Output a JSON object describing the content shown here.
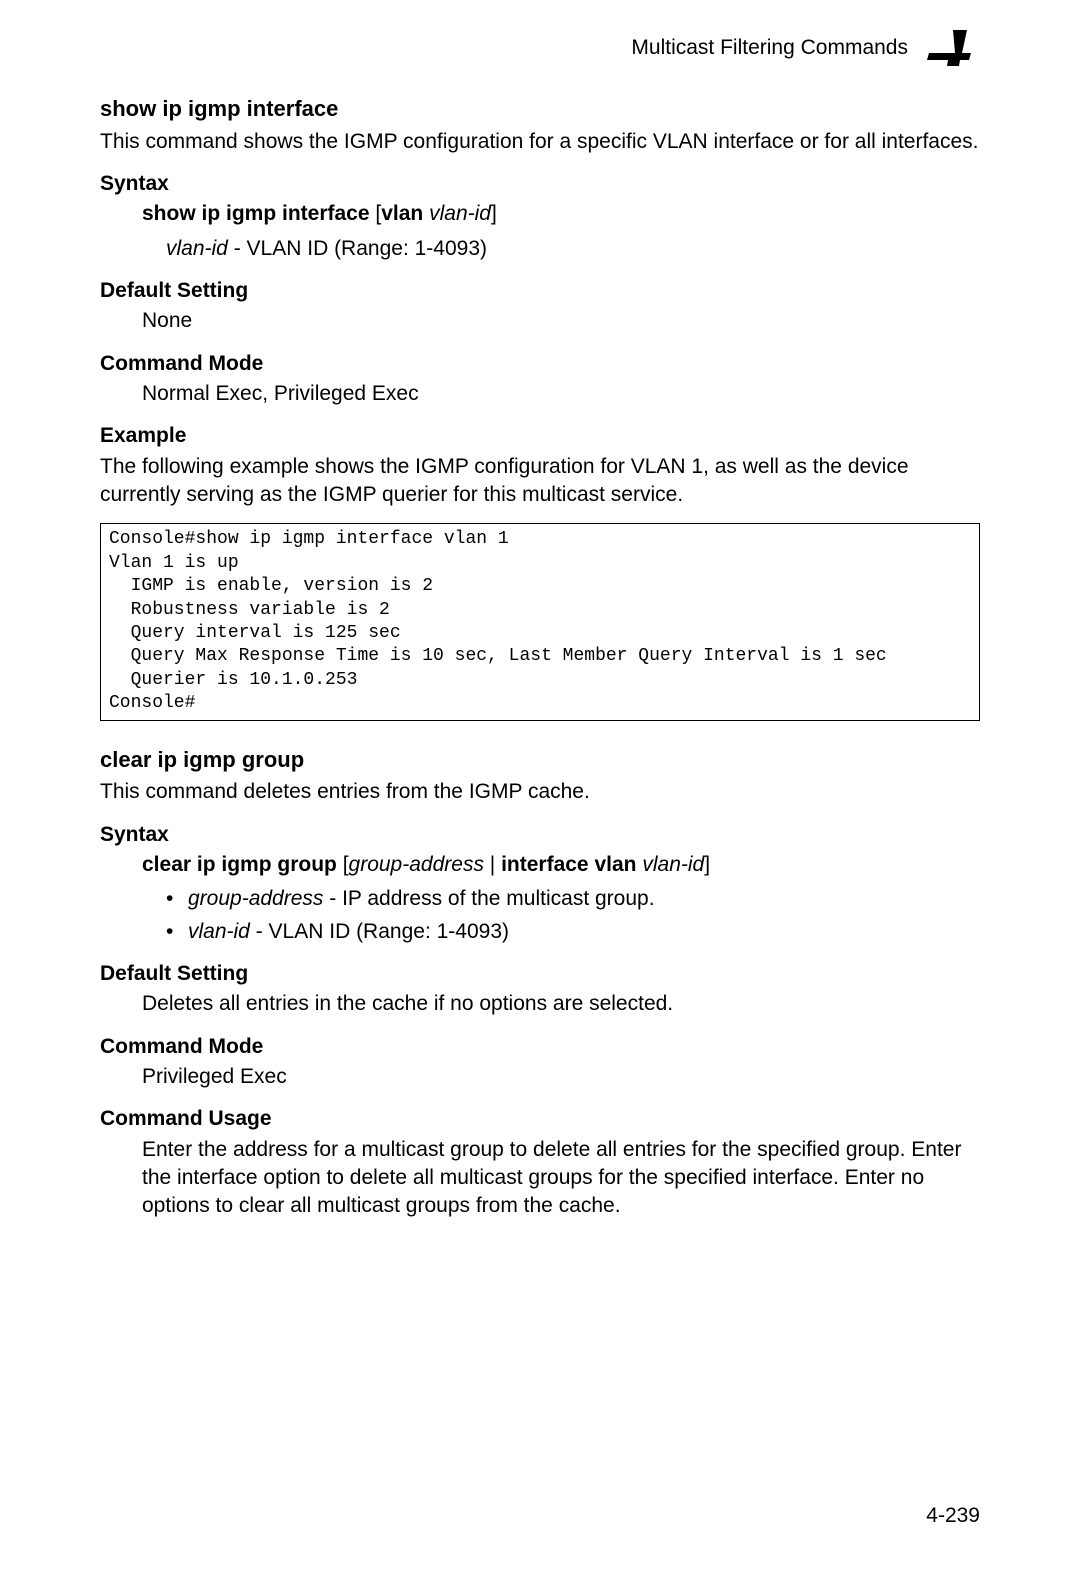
{
  "header": {
    "title": "Multicast Filtering Commands",
    "chapter_number": "4"
  },
  "section1": {
    "title": "show ip igmp interface",
    "intro": "This command shows the IGMP configuration for a specific VLAN interface or for all interfaces.",
    "syntax_label": "Syntax",
    "syntax_bold_a": "show ip igmp interface",
    "syntax_plain_a": " [",
    "syntax_bold_b": "vlan",
    "syntax_plain_b": " ",
    "syntax_ital_a": "vlan-id",
    "syntax_plain_c": "]",
    "param_ital": "vlan-id",
    "param_rest": " - VLAN ID (Range: 1-4093)",
    "default_label": "Default Setting",
    "default_value": "None",
    "mode_label": "Command Mode",
    "mode_value": "Normal Exec, Privileged Exec",
    "example_label": "Example",
    "example_intro": "The following example shows the IGMP configuration for VLAN 1, as well as the device currently serving as the IGMP querier for this multicast service.",
    "code": "Console#show ip igmp interface vlan 1\nVlan 1 is up\n  IGMP is enable, version is 2\n  Robustness variable is 2\n  Query interval is 125 sec\n  Query Max Response Time is 10 sec, Last Member Query Interval is 1 sec\n  Querier is 10.1.0.253\nConsole#"
  },
  "section2": {
    "title": "clear ip igmp group",
    "intro": "This command deletes entries from the IGMP cache.",
    "syntax_label": "Syntax",
    "syntax_bold_a": "clear ip igmp group",
    "syntax_plain_a": " [",
    "syntax_ital_a": "group-address",
    "syntax_plain_b": " | ",
    "syntax_bold_b": "interface",
    "syntax_plain_c": " ",
    "syntax_bold_c": "vlan",
    "syntax_plain_d": " ",
    "syntax_ital_b": "vlan-id",
    "syntax_plain_e": "]",
    "bullets": [
      {
        "ital": "group-address",
        "rest": " - IP address of the multicast group."
      },
      {
        "ital": "vlan-id",
        "rest": " - VLAN ID (Range: 1-4093)"
      }
    ],
    "default_label": "Default Setting",
    "default_value": "Deletes all entries in the cache if no options are selected.",
    "mode_label": "Command Mode",
    "mode_value": "Privileged Exec",
    "usage_label": "Command Usage",
    "usage_value": "Enter the address for a multicast group to delete all entries for the specified group. Enter the interface option to delete all multicast groups for the specified interface. Enter no options to clear all multicast groups from the cache."
  },
  "page_number": "4-239"
}
